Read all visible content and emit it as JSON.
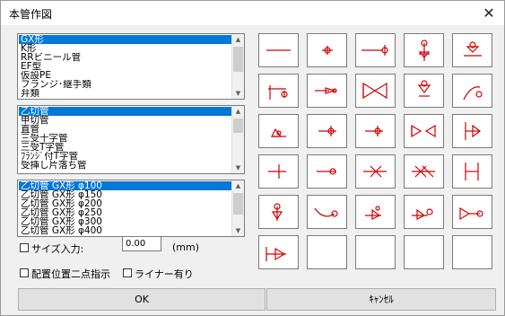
{
  "window": {
    "title": "本管作図",
    "close_glyph": "✕"
  },
  "list1": {
    "items": [
      "GX形",
      "K形",
      "RRビニール管",
      "EF型",
      "仮設PE",
      "フランジ･継手類",
      "弁類"
    ]
  },
  "list2": {
    "items": [
      "乙切管",
      "甲切管",
      "直管",
      "三受十字管",
      "三受T字管",
      "ﾌﾗﾝｼﾞ付T字管",
      "受挿し片落ち管"
    ]
  },
  "list3": {
    "items": [
      "乙切管 GX形 φ100",
      "乙切管 GX形 φ150",
      "乙切管 GX形 φ200",
      "乙切管 GX形 φ250",
      "乙切管 GX形 φ300",
      "乙切管 GX形 φ400"
    ]
  },
  "options": {
    "size_input_label": "サイズ入力:",
    "size_value": "0.00",
    "size_unit": "(mm)",
    "two_point_label": "配置位置二点指示",
    "liner_label": "ライナー有り"
  },
  "buttons": {
    "ok": "OK",
    "cancel": "ｷｬﾝｾﾙ"
  },
  "palette": {
    "color": "#d00000",
    "cells": [
      "straight-pipe-icon",
      "socket-joint-icon",
      "pipe-with-socket-icon",
      "valve-with-handwheel-icon",
      "valve-end-icon",
      "tee-branch-icon",
      "reducer-icon",
      "gate-valve-icon",
      "vertical-valve-icon",
      "bend-icon",
      "bend-socket-icon",
      "socket-bend-icon",
      "socket-end-icon",
      "double-socket-valve-icon",
      "flange-joint-icon",
      "cap-icon",
      "short-socket-icon",
      "sleeve-icon",
      "double-sleeve-icon",
      "h-joint-icon",
      "fire-hydrant-icon",
      "curved-pipe-icon",
      "angle-socket-icon",
      "elbow-socket-icon",
      "double-elbow-icon",
      "adapter-icon",
      "empty",
      "empty",
      "empty",
      "empty"
    ]
  }
}
